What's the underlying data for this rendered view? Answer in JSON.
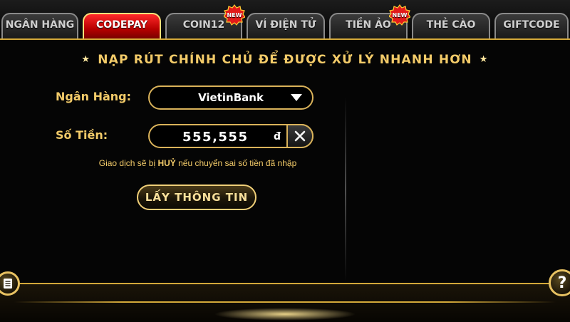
{
  "tabs": [
    {
      "label": "NGÂN HÀNG",
      "active": false,
      "new": false
    },
    {
      "label": "CODEPAY",
      "active": true,
      "new": false
    },
    {
      "label": "COIN12",
      "active": false,
      "new": true
    },
    {
      "label": "VÍ ĐIỆN TỬ",
      "active": false,
      "new": false
    },
    {
      "label": "TIỀN ẢO",
      "active": false,
      "new": true
    },
    {
      "label": "THẺ CÀO",
      "active": false,
      "new": false
    },
    {
      "label": "GIFTCODE",
      "active": false,
      "new": false
    }
  ],
  "badge": {
    "label": "NEW"
  },
  "title": "NẠP RÚT CHÍNH CHỦ ĐỂ ĐƯỢC XỬ LÝ NHANH HƠN",
  "form": {
    "bank_label": "Ngân Hàng:",
    "bank_value": "VietinBank",
    "amount_label": "Số Tiền:",
    "amount_value": "555,555",
    "amount_unit": "đ"
  },
  "note": {
    "prefix": "Giao dịch sẽ bị ",
    "emphasis": "HUỶ",
    "suffix": " nếu chuyển sai số tiền đã nhập"
  },
  "action_button": "LẤY THÔNG TIN",
  "help_button": "?",
  "colors": {
    "gold": "#f3cb69",
    "gold_border": "#d9b25a",
    "active_tab": "#d10000"
  }
}
